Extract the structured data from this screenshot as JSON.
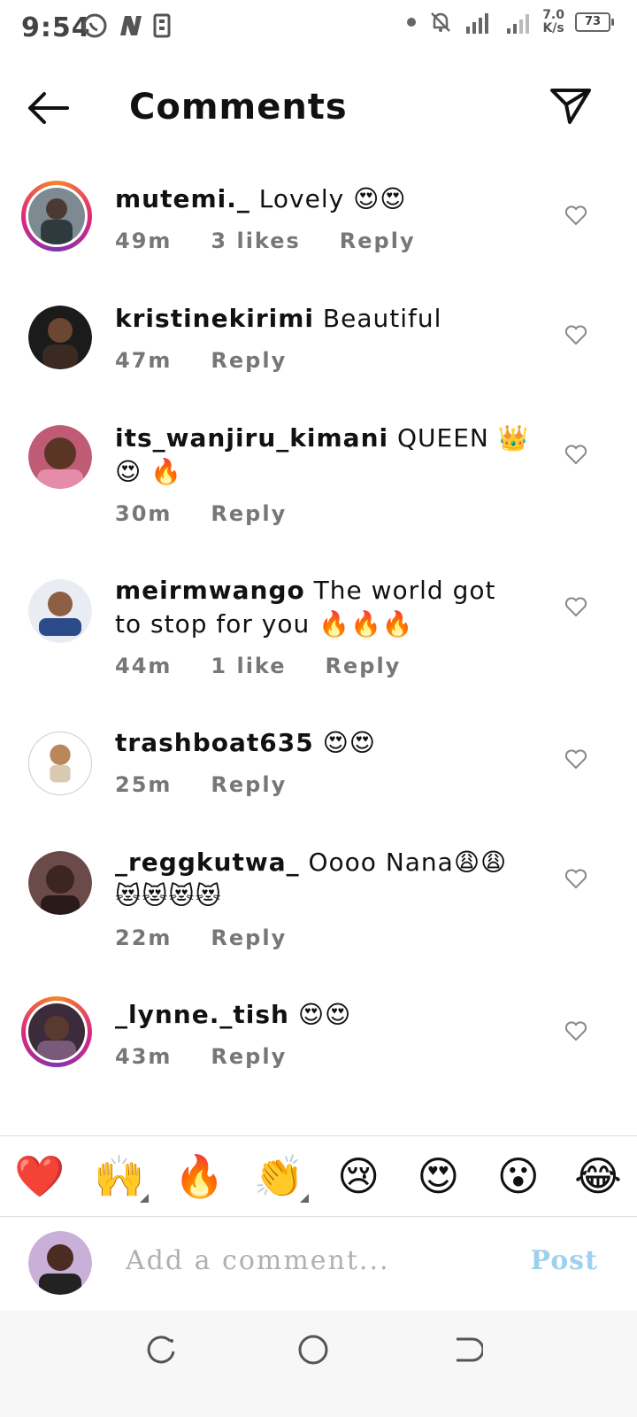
{
  "status": {
    "time": "9:54",
    "net_speed_top": "7.0",
    "net_speed_bottom": "K/s",
    "battery": "73"
  },
  "header": {
    "title": "Comments"
  },
  "comments": [
    {
      "user": "mutemi._",
      "text": " Lovely 😍😍",
      "time": "49m",
      "likes": "3 likes",
      "reply": "Reply"
    },
    {
      "user": "kristinekirimi",
      "text": " Beautiful",
      "time": "47m",
      "reply": "Reply"
    },
    {
      "user": "its_wanjiru_kimani",
      "text": " QUEEN 👑 😍 🔥",
      "time": "30m",
      "reply": "Reply"
    },
    {
      "user": "meirmwango",
      "text": " The world got to stop for you 🔥🔥🔥",
      "time": "44m",
      "likes": "1 like",
      "reply": "Reply"
    },
    {
      "user": "trashboat635",
      "text": " 😍😍",
      "time": "25m",
      "reply": "Reply"
    },
    {
      "user": "_reggkutwa_",
      "text": " Oooo Nana😩😩😻😻😻😻",
      "time": "22m",
      "reply": "Reply"
    },
    {
      "user": "_lynne._tish",
      "text": " 😍😍",
      "time": "43m",
      "reply": "Reply"
    }
  ],
  "reactions": [
    "❤️",
    "🙌",
    "🔥",
    "👏",
    "😢",
    "😍",
    "😮",
    "😂"
  ],
  "composer": {
    "placeholder": "Add a comment...",
    "post": "Post"
  },
  "colors": {
    "accent": "#9fd1ef",
    "meta": "#777777",
    "heart": "#e0245e"
  }
}
